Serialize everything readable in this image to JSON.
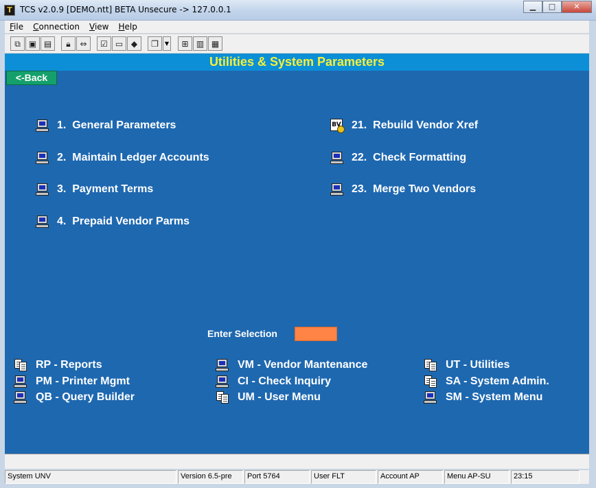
{
  "window": {
    "title": "TCS v2.0.9 [DEMO.ntt] BETA Unsecure -> 127.0.0.1",
    "app_icon_letter": "T",
    "minimize": "▁",
    "maximize": "□",
    "close": "✕"
  },
  "menu": [
    {
      "u": "F",
      "rest": "ile"
    },
    {
      "u": "C",
      "rest": "onnection"
    },
    {
      "u": "V",
      "rest": "iew"
    },
    {
      "u": "H",
      "rest": "elp"
    }
  ],
  "toolbar": {
    "icons": [
      "copy-icon",
      "save-icon",
      "print-icon",
      "lock-icon",
      "connect-icon",
      "properties-icon",
      "monitor-icon",
      "book-icon",
      "window-icon",
      "dropdown-icon",
      "tree-icon",
      "chart-icon",
      "calculator-icon"
    ]
  },
  "header": {
    "title": "Utilities & System Parameters"
  },
  "back_label": "<-Back",
  "options_left": [
    {
      "num": "1.",
      "label": "General Parameters",
      "icon": "computer-icon"
    },
    {
      "num": "2.",
      "label": "Maintain Ledger Accounts",
      "icon": "computer-icon"
    },
    {
      "num": "3.",
      "label": "Payment Terms",
      "icon": "computer-icon"
    },
    {
      "num": "4.",
      "label": "Prepaid Vendor Parms",
      "icon": "computer-icon"
    }
  ],
  "options_right": [
    {
      "num": "21.",
      "label": "Rebuild Vendor Xref",
      "icon": "batch-icon",
      "icon_text": "BV"
    },
    {
      "num": "22.",
      "label": "Check Formatting",
      "icon": "computer-icon"
    },
    {
      "num": "23.",
      "label": "Merge Two Vendors",
      "icon": "computer-icon"
    }
  ],
  "enter_selection": {
    "label": "Enter Selection",
    "value": ""
  },
  "nav_links": [
    {
      "code": "RP - Reports",
      "icon": "documents-icon"
    },
    {
      "code": "PM - Printer Mgmt",
      "icon": "computer-icon"
    },
    {
      "code": "QB - Query Builder",
      "icon": "computer-icon"
    },
    {
      "code": "VM - Vendor Mantenance",
      "icon": "computer-icon"
    },
    {
      "code": "CI - Check Inquiry",
      "icon": "computer-icon"
    },
    {
      "code": "UM - User Menu",
      "icon": "documents-icon"
    },
    {
      "code": "UT - Utilities",
      "icon": "documents-icon"
    },
    {
      "code": "SA - System Admin.",
      "icon": "documents-icon"
    },
    {
      "code": "SM - System Menu",
      "icon": "computer-icon"
    }
  ],
  "status": {
    "system": "System UNV",
    "version": "Version 6.5-pre",
    "port": "Port 5764",
    "user": "User FLT",
    "account": "Account AP",
    "menu": "Menu AP-SU",
    "time": "23:15"
  },
  "colors": {
    "panel_bg": "#1e68b0",
    "header_bg": "#0c8fd6",
    "header_text": "#f6f03a",
    "back_button": "#15a06b",
    "selection_input": "#ff8445"
  }
}
